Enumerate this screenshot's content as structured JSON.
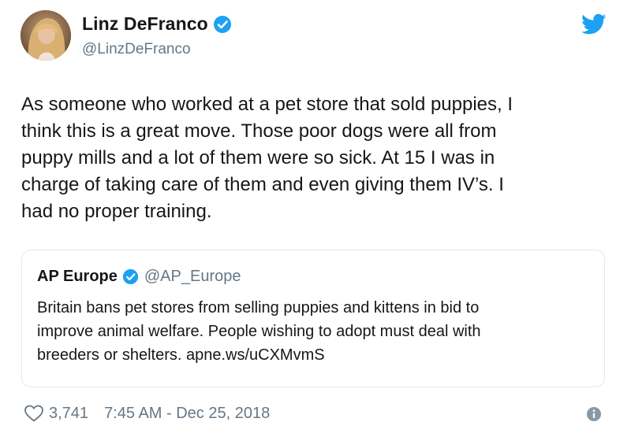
{
  "author": {
    "display_name": "Linz DeFranco",
    "handle": "@LinzDeFranco",
    "verified": true
  },
  "tweet": {
    "text": "As someone who worked at a pet store that sold puppies, I\nthink this is a great move. Those poor dogs were all from\npuppy mills and a lot of them were so sick. At 15 I was in\ncharge of taking care of them and even giving them IV’s. I\nhad no proper training."
  },
  "quoted": {
    "display_name": "AP Europe",
    "handle": "@AP_Europe",
    "verified": true,
    "text": "Britain bans pet stores from selling puppies and kittens in bid to\nimprove animal welfare. People wishing to adopt must deal with\nbreeders or shelters. apne.ws/uCXMvmS"
  },
  "footer": {
    "likes": "3,741",
    "timestamp": "7:45 AM - Dec 25, 2018"
  },
  "icons": {
    "verified": "verified-badge-icon",
    "bird": "twitter-bird-icon",
    "heart": "heart-icon",
    "info": "info-icon"
  },
  "colors": {
    "brand_blue": "#1da1f2",
    "text": "#14171a",
    "muted": "#657786",
    "border": "#e1e8ed"
  }
}
